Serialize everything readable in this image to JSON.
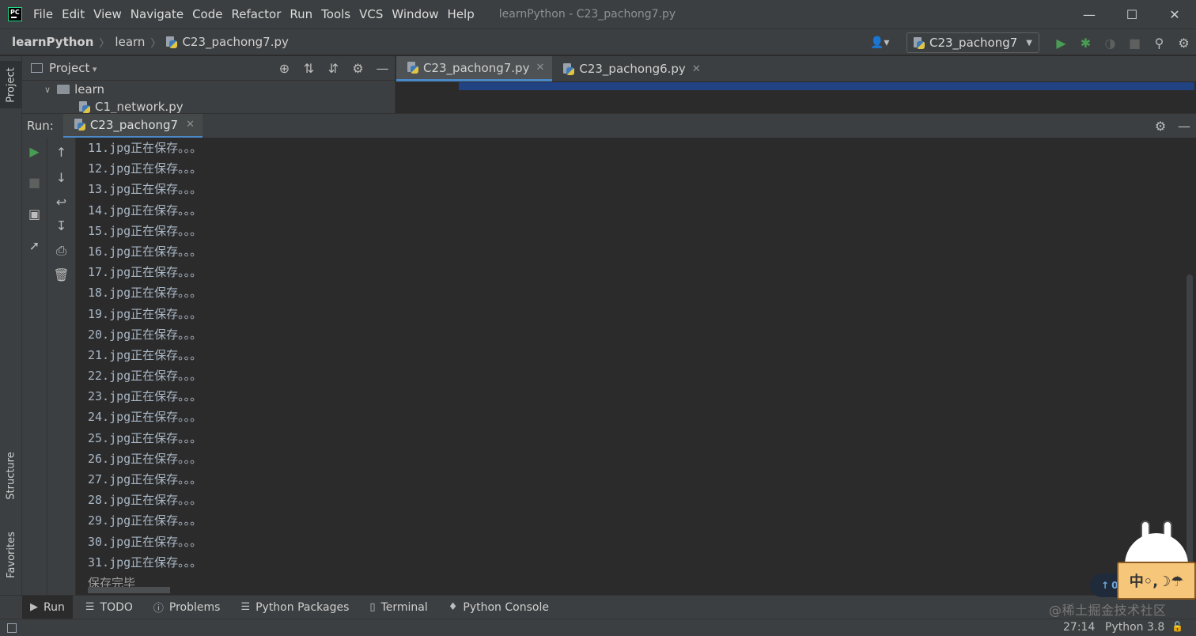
{
  "app": {
    "logo": "PC",
    "window_title": "learnPython - C23_pachong7.py"
  },
  "menu": [
    "File",
    "Edit",
    "View",
    "Navigate",
    "Code",
    "Refactor",
    "Run",
    "Tools",
    "VCS",
    "Window",
    "Help"
  ],
  "breadcrumb": {
    "project": "learnPython",
    "folder": "learn",
    "file": "C23_pachong7.py"
  },
  "run_config": "C23_pachong7",
  "left_strip": {
    "project": "Project",
    "structure": "Structure",
    "favorites": "Favorites"
  },
  "project_panel": {
    "title": "Project",
    "tree": [
      {
        "name": "learn",
        "type": "folder"
      },
      {
        "name": "C1_network.py",
        "type": "file"
      }
    ]
  },
  "editor_tabs": [
    {
      "label": "C23_pachong7.py",
      "active": true
    },
    {
      "label": "C23_pachong6.py",
      "active": false
    }
  ],
  "run_panel": {
    "label": "Run:",
    "tab": "C23_pachong7",
    "output": [
      "11.jpg正在保存。。。",
      "12.jpg正在保存。。。",
      "13.jpg正在保存。。。",
      "14.jpg正在保存。。。",
      "15.jpg正在保存。。。",
      "16.jpg正在保存。。。",
      "17.jpg正在保存。。。",
      "18.jpg正在保存。。。",
      "19.jpg正在保存。。。",
      "20.jpg正在保存。。。",
      "21.jpg正在保存。。。",
      "22.jpg正在保存。。。",
      "23.jpg正在保存。。。",
      "24.jpg正在保存。。。",
      "25.jpg正在保存。。。",
      "26.jpg正在保存。。。",
      "27.jpg正在保存。。。",
      "28.jpg正在保存。。。",
      "29.jpg正在保存。。。",
      "30.jpg正在保存。。。",
      "31.jpg正在保存。。。",
      "保存完毕"
    ]
  },
  "bottom_tabs": [
    {
      "label": "Run",
      "icon": "play-icon",
      "active": true
    },
    {
      "label": "TODO",
      "icon": "list-icon",
      "active": false
    },
    {
      "label": "Problems",
      "icon": "info-icon",
      "active": false
    },
    {
      "label": "Python Packages",
      "icon": "layers-icon",
      "active": false
    },
    {
      "label": "Terminal",
      "icon": "terminal-icon",
      "active": false
    },
    {
      "label": "Python Console",
      "icon": "python-icon",
      "active": false
    }
  ],
  "status": {
    "position": "27:14",
    "interpreter": "Python 3.8"
  },
  "overlay": {
    "watermark": "@稀土掘金技术社区",
    "badge": "0",
    "mascot_text": "中◦,☽☂"
  },
  "colors": {
    "accent": "#4a88c7",
    "run_green": "#499c54",
    "background": "#2b2b2b",
    "panel": "#3c3f41"
  }
}
